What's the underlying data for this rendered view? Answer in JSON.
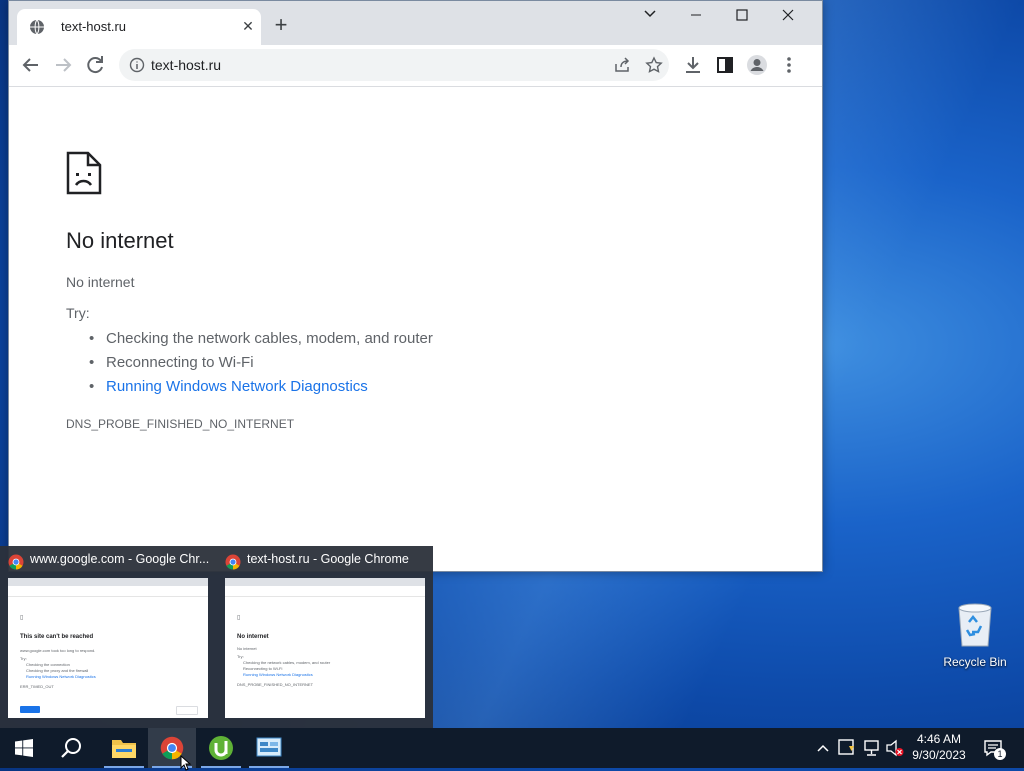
{
  "browser": {
    "tab": {
      "title": "text-host.ru"
    },
    "url": "text-host.ru",
    "page": {
      "title": "No internet",
      "subtitle": "No internet",
      "try_label": "Try:",
      "suggestions": [
        "Checking the network cables, modem, and router",
        "Reconnecting to Wi-Fi",
        "Running Windows Network Diagnostics"
      ],
      "error_code": "DNS_PROBE_FINISHED_NO_INTERNET"
    }
  },
  "taskbar_preview": {
    "items": [
      {
        "title": "www.google.com - Google Chr...",
        "thumb": {
          "heading": "This site can't be reached",
          "line": "www.google.com took too long to respond.",
          "try": "Try:",
          "items": [
            "Checking the connection",
            "Checking the proxy and the firewall",
            "Running Windows Network Diagnostics"
          ],
          "code": "ERR_TIMED_OUT"
        }
      },
      {
        "title": "text-host.ru - Google Chrome",
        "thumb": {
          "heading": "No internet",
          "line": "No internet",
          "try": "Try:",
          "items": [
            "Checking the network cables, modem, and router",
            "Reconnecting to Wi-Fi",
            "Running Windows Network Diagnostics"
          ],
          "code": "DNS_PROBE_FINISHED_NO_INTERNET"
        }
      }
    ]
  },
  "desktop": {
    "recycle_bin_label": "Recycle Bin"
  },
  "taskbar": {
    "apps": [
      "start",
      "search",
      "file-explorer",
      "chrome",
      "utorrent",
      "control-panel"
    ],
    "clock": {
      "time": "4:46 AM",
      "date": "9/30/2023"
    },
    "notification_count": "1"
  },
  "colors": {
    "link": "#1a73e8",
    "taskbar": "#0f1b2b"
  }
}
